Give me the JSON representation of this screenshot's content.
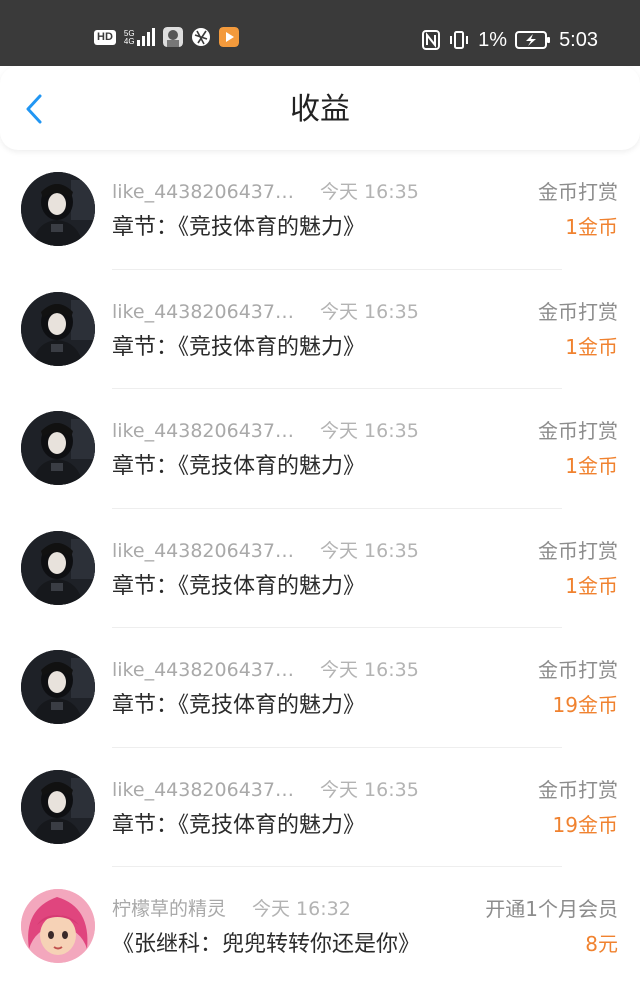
{
  "status_bar": {
    "hd": "HD",
    "net_top": "5G",
    "net_bottom": "4G",
    "battery_percent": "1%",
    "clock": "5:03",
    "icons": [
      "hd-icon",
      "signal-icon",
      "app-icon",
      "app-icon",
      "app-icon",
      "nfc-icon",
      "vibrate-icon",
      "battery-charging-icon"
    ]
  },
  "header": {
    "title": "收益",
    "back_icon": "chevron-left-icon",
    "accent_color": "#2196f3"
  },
  "colors": {
    "amount": "#f0822f",
    "muted": "#a9a9a9"
  },
  "rows": [
    {
      "user": "like_4438206437…",
      "time": "今天 16:35",
      "type": "金币打赏",
      "chapter": "章节：《竞技体育的魅力》",
      "amount": "1金币",
      "avatar": "girl-avatar"
    },
    {
      "user": "like_4438206437…",
      "time": "今天 16:35",
      "type": "金币打赏",
      "chapter": "章节：《竞技体育的魅力》",
      "amount": "1金币",
      "avatar": "girl-avatar"
    },
    {
      "user": "like_4438206437…",
      "time": "今天 16:35",
      "type": "金币打赏",
      "chapter": "章节：《竞技体育的魅力》",
      "amount": "1金币",
      "avatar": "girl-avatar"
    },
    {
      "user": "like_4438206437…",
      "time": "今天 16:35",
      "type": "金币打赏",
      "chapter": "章节：《竞技体育的魅力》",
      "amount": "1金币",
      "avatar": "girl-avatar"
    },
    {
      "user": "like_4438206437…",
      "time": "今天 16:35",
      "type": "金币打赏",
      "chapter": "章节：《竞技体育的魅力》",
      "amount": "19金币",
      "avatar": "girl-avatar"
    },
    {
      "user": "like_4438206437…",
      "time": "今天 16:35",
      "type": "金币打赏",
      "chapter": "章节：《竞技体育的魅力》",
      "amount": "19金币",
      "avatar": "girl-avatar"
    },
    {
      "user": "柠檬草的精灵",
      "time": "今天 16:32",
      "type": "开通1个月会员",
      "chapter": "《张继科：兜兜转转你还是你》",
      "amount": "8元",
      "avatar": "cartoon-avatar"
    }
  ]
}
